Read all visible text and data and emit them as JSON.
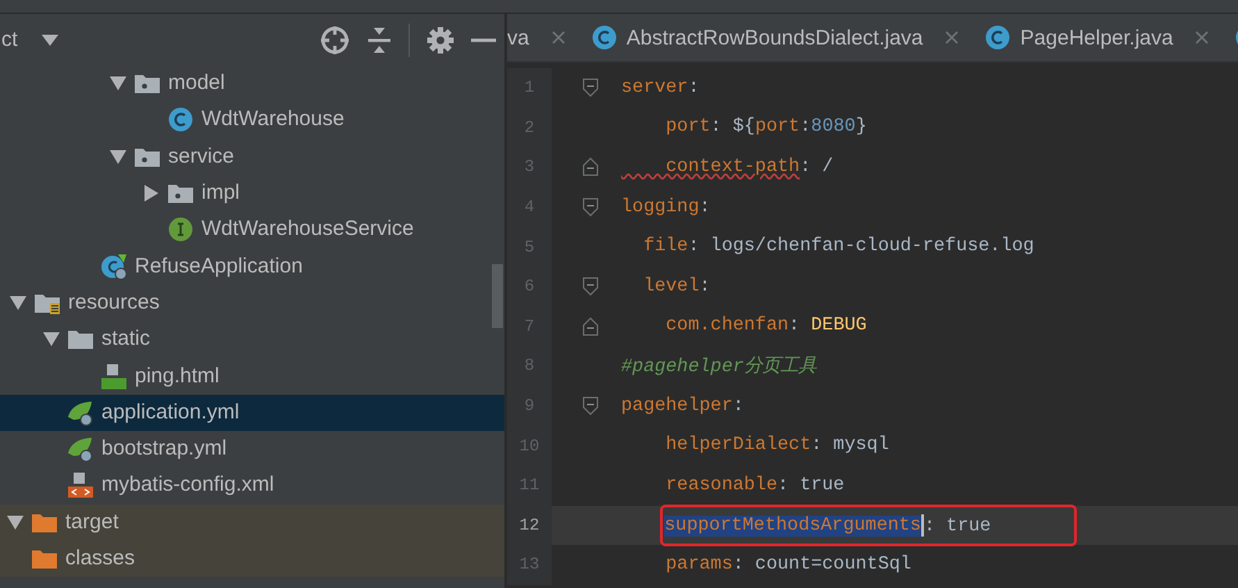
{
  "project_panel": {
    "title": "ct",
    "tree": [
      {
        "label": "model",
        "kind": "package",
        "expanded": true,
        "selected": false,
        "children": [
          {
            "label": "WdtWarehouse",
            "kind": "class",
            "selected": false
          }
        ]
      },
      {
        "label": "service",
        "kind": "package",
        "expanded": true,
        "selected": false,
        "children": [
          {
            "label": "impl",
            "kind": "package",
            "expanded": false,
            "selected": false
          },
          {
            "label": "WdtWarehouseService",
            "kind": "interface",
            "selected": false
          }
        ]
      },
      {
        "label": "RefuseApplication",
        "kind": "spring-app",
        "selected": false
      },
      {
        "label": "resources",
        "kind": "resource-root",
        "expanded": true,
        "selected": false,
        "children": [
          {
            "label": "static",
            "kind": "folder",
            "expanded": true,
            "selected": false,
            "children": [
              {
                "label": "ping.html",
                "kind": "html",
                "selected": false
              }
            ]
          },
          {
            "label": "application.yml",
            "kind": "yml",
            "selected": true
          },
          {
            "label": "bootstrap.yml",
            "kind": "yml",
            "selected": false
          },
          {
            "label": "mybatis-config.xml",
            "kind": "xml",
            "selected": false
          }
        ]
      },
      {
        "label": "target",
        "kind": "excluded-folder",
        "expanded": true,
        "selected": false,
        "children": [
          {
            "label": "classes",
            "kind": "excluded-folder",
            "selected": false
          }
        ]
      }
    ]
  },
  "editor": {
    "tabs": [
      {
        "label": "va",
        "kind": "none",
        "selected": false
      },
      {
        "label": "AbstractRowBoundsDialect.java",
        "kind": "class",
        "selected": false
      },
      {
        "label": "PageHelper.java",
        "kind": "class",
        "selected": false
      },
      {
        "kind": "class",
        "selected": false
      }
    ],
    "lines": [
      {
        "number": "1",
        "kind": "block-start",
        "current": false,
        "boxed": false,
        "tokens": [
          {
            "kind": "key",
            "text": "server"
          },
          {
            "kind": "plain",
            "text": ":"
          }
        ]
      },
      {
        "number": "2",
        "kind": "line",
        "current": false,
        "boxed": false,
        "tokens": [
          {
            "kind": "key",
            "text": "    port"
          },
          {
            "kind": "plain",
            "text": ": ${"
          },
          {
            "kind": "key",
            "text": "port"
          },
          {
            "kind": "plain",
            "text": ":"
          },
          {
            "kind": "number",
            "text": "8080"
          },
          {
            "kind": "plain",
            "text": "}"
          }
        ]
      },
      {
        "number": "3",
        "kind": "block-end",
        "current": false,
        "boxed": false,
        "tokens": [
          {
            "kind": "key-warning",
            "text": "    context-path"
          },
          {
            "kind": "plain",
            "text": ": /"
          }
        ]
      },
      {
        "number": "4",
        "kind": "block-start",
        "current": false,
        "boxed": false,
        "tokens": [
          {
            "kind": "key",
            "text": "logging"
          },
          {
            "kind": "plain",
            "text": ":"
          }
        ]
      },
      {
        "number": "5",
        "kind": "line",
        "current": false,
        "boxed": false,
        "tokens": [
          {
            "kind": "key",
            "text": "  file"
          },
          {
            "kind": "plain",
            "text": ": logs/chenfan-cloud-refuse.log"
          }
        ]
      },
      {
        "number": "6",
        "kind": "block-start",
        "current": false,
        "boxed": false,
        "tokens": [
          {
            "kind": "key",
            "text": "  level"
          },
          {
            "kind": "plain",
            "text": ":"
          }
        ]
      },
      {
        "number": "7",
        "kind": "block-end",
        "current": false,
        "boxed": false,
        "tokens": [
          {
            "kind": "key",
            "text": "    com.chenfan"
          },
          {
            "kind": "plain",
            "text": ": "
          },
          {
            "kind": "constant",
            "text": "DEBUG"
          }
        ]
      },
      {
        "number": "8",
        "kind": "line",
        "current": false,
        "boxed": false,
        "tokens": [
          {
            "kind": "comment",
            "text": "#pagehelper分页工具"
          }
        ]
      },
      {
        "number": "9",
        "kind": "block-start",
        "current": false,
        "boxed": false,
        "tokens": [
          {
            "kind": "key",
            "text": "pagehelper"
          },
          {
            "kind": "plain",
            "text": ":"
          }
        ]
      },
      {
        "number": "10",
        "kind": "line",
        "current": false,
        "boxed": false,
        "tokens": [
          {
            "kind": "key",
            "text": "    helperDialect"
          },
          {
            "kind": "plain",
            "text": ": mysql"
          }
        ]
      },
      {
        "number": "11",
        "kind": "line",
        "current": false,
        "boxed": false,
        "tokens": [
          {
            "kind": "key",
            "text": "    reasonable"
          },
          {
            "kind": "plain",
            "text": ": true"
          }
        ]
      },
      {
        "number": "12",
        "kind": "line",
        "current": true,
        "boxed": true,
        "tokens": [
          {
            "kind": "key-selected",
            "text": "supportMethodsArguments"
          },
          {
            "kind": "caret"
          },
          {
            "kind": "plain",
            "text": ": true"
          }
        ]
      },
      {
        "number": "13",
        "kind": "line",
        "current": false,
        "boxed": false,
        "tokens": [
          {
            "kind": "key",
            "text": "    params"
          },
          {
            "kind": "plain",
            "text": ": count=countSql"
          }
        ]
      }
    ]
  }
}
